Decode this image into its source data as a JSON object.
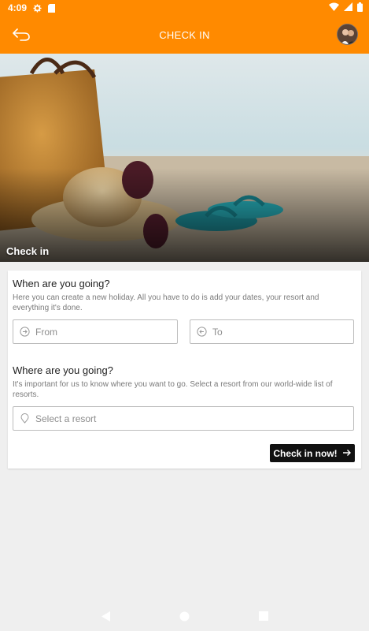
{
  "status_bar": {
    "time": "4:09",
    "icons": [
      "gear-icon",
      "sim-card-icon",
      "wifi-icon",
      "signal-icon",
      "battery-icon"
    ]
  },
  "app_bar": {
    "title": "CHECK IN",
    "back_icon": "back-arrow-icon",
    "avatar": "profile-avatar"
  },
  "hero": {
    "caption": "Check in"
  },
  "form": {
    "when": {
      "title": "When are you going?",
      "description": "Here you can create a new holiday. All you have to do is add your dates, your resort and everything it's done.",
      "from_placeholder": "From",
      "to_placeholder": "To"
    },
    "where": {
      "title": "Where are you going?",
      "description": "It's important for us to know where you want to go. Select a resort from our world-wide list of resorts.",
      "resort_placeholder": "Select a resort"
    },
    "submit_label": "Check in now!"
  },
  "colors": {
    "accent": "#ff8a00",
    "button": "#111111",
    "background": "#efefef"
  }
}
